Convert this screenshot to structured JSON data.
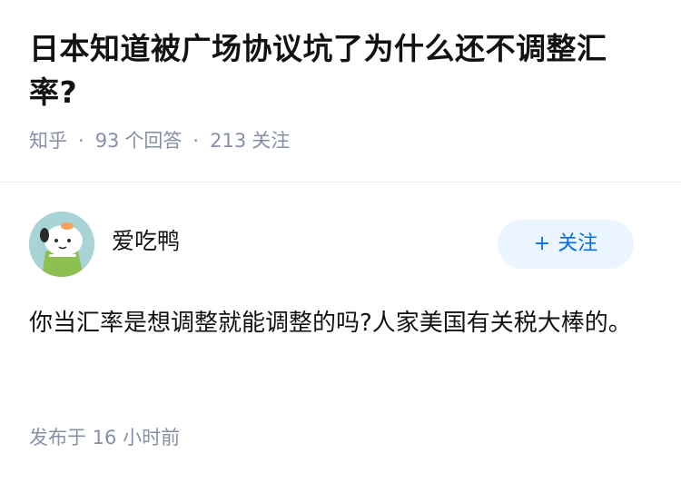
{
  "question": {
    "title": "日本知道被广场协议坑了为什么还不调整汇率?",
    "source": "知乎",
    "answers_count": "93",
    "answers_label": "个回答",
    "followers_count": "213",
    "followers_label": "关注"
  },
  "answer": {
    "author": {
      "name": "爱吃鸭",
      "avatar_icon": "cartoon-dog-avatar-icon"
    },
    "follow_button": {
      "icon": "+",
      "label": "关注"
    },
    "content": "你当汇率是想调整就能调整的吗?人家美国有关税大棒的。",
    "published": "发布于 16 小时前"
  },
  "colors": {
    "meta_gray": "#8590a6",
    "follow_blue": "#056de8",
    "follow_bg": "#ebf5ff",
    "divider": "#ebebeb"
  }
}
